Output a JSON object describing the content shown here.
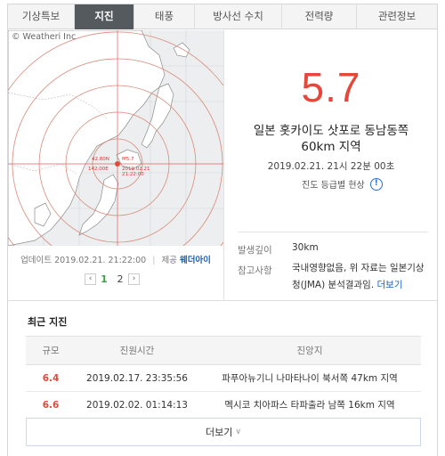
{
  "tabs": [
    "기상특보",
    "지진",
    "태풍",
    "방사선 수치",
    "전력량",
    "관련정보"
  ],
  "map": {
    "copyright": "© Weatheri Inc",
    "epicenter_lat": "42.80N",
    "epicenter_lon": "142.00E",
    "magnitude_tag": "M5.7",
    "date_tag": "2019.02.21",
    "time_tag": "21:22:00"
  },
  "update": {
    "label": "업데이트",
    "datetime": "2019.02.21. 21:22:00",
    "source_label": "제공",
    "source": "웨더아이"
  },
  "pager": {
    "prev": "‹",
    "pages": [
      "1",
      "2"
    ],
    "next": "›"
  },
  "quake": {
    "magnitude": "5.7",
    "location_line1": "일본 홋카이도 삿포로 동남동쪽",
    "location_line2": "60km 지역",
    "datetime": "2019.02.21. 21시 22분 00초",
    "intensity_label": "진도 등급별 현상"
  },
  "details": {
    "depth_label": "발생깊이",
    "depth": "30km",
    "ref_label": "참고사항",
    "ref_line1": "국내영향없음, 위 자료는 일본기상",
    "ref_line2": "청(JMA) 분석결과임.",
    "ref_more": "더보기"
  },
  "recent": {
    "title": "최근 지진",
    "headers": [
      "규모",
      "진원시간",
      "진앙지"
    ],
    "rows": [
      {
        "mag": "6.4",
        "time": "2019.02.17. 23:35:56",
        "place": "파푸아뉴기니 나마타나이 북서쪽 47km 지역"
      },
      {
        "mag": "6.6",
        "time": "2019.02.02. 01:14:13",
        "place": "멕시코 치아파스 타파출라 남쪽 16km 지역"
      }
    ],
    "more_label": "더보기"
  },
  "colors": {
    "accent_red": "#e5483b",
    "tab_active": "#555a5f",
    "link_blue": "#1a5fb4"
  }
}
